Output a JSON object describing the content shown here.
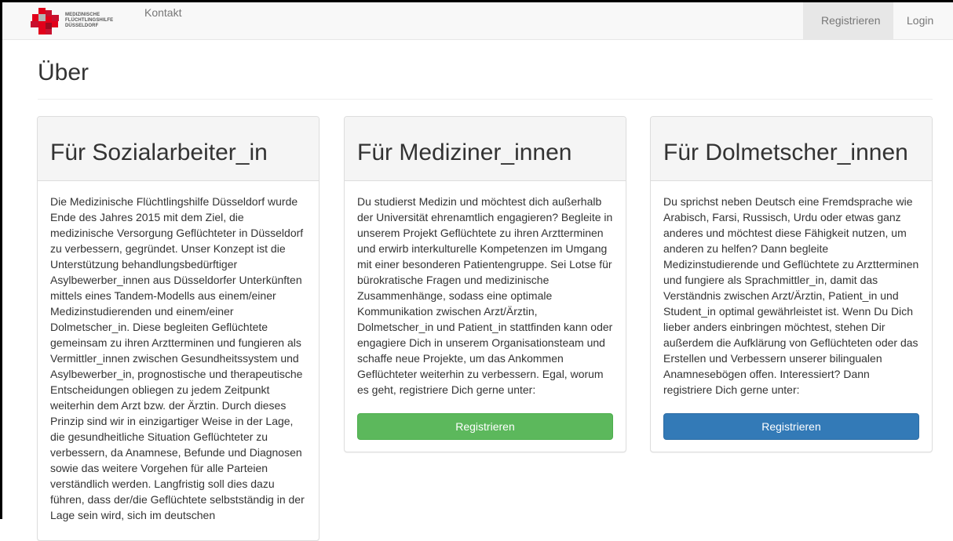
{
  "navbar": {
    "logo_lines": [
      "MEDIZINISCHE",
      "FLÜCHTLINGSHILFE",
      "DÜSSELDORF"
    ],
    "contact_label": "Kontakt",
    "register_label": "Registrieren",
    "login_label": "Login"
  },
  "page": {
    "title": "Über"
  },
  "panels": [
    {
      "heading": "Für Sozialarbeiter_in",
      "text": "Die Medizinische Flüchtlingshilfe Düsseldorf wurde Ende des Jahres 2015 mit dem Ziel, die medizinische Versorgung Geflüchteter in Düsseldorf zu verbessern, gegründet. Unser Konzept ist die Unterstützung behandlungsbedürftiger Asylbewerber_innen aus Düsseldorfer Unterkünften mittels eines Tandem-Modells aus einem/einer Medizinstudierenden und einem/einer Dolmetscher_in. Diese begleiten Geflüchtete gemeinsam zu ihren Arztterminen und fungieren als Vermittler_innen zwischen Gesundheitssystem und Asylbewerber_in, prognostische und therapeutische Entscheidungen obliegen zu jedem Zeitpunkt weiterhin dem Arzt bzw. der Ärztin. Durch dieses Prinzip sind wir in einzigartiger Weise in der Lage, die gesundheitliche Situation Geflüchteter zu verbessern, da Anamnese, Befunde und Diagnosen sowie das weitere Vorgehen für alle Parteien verständlich werden. Langfristig soll dies dazu führen, dass der/die Geflüchtete selbstständig in der Lage sein wird, sich im deutschen"
    },
    {
      "heading": "Für Mediziner_innen",
      "text": "Du studierst Medizin und möchtest dich außerhalb der Universität ehrenamtlich engagieren? Begleite in unserem Projekt Geflüchtete zu ihren Arztterminen und erwirb interkulturelle Kompetenzen im Umgang mit einer besonderen Patientengruppe. Sei Lotse für bürokratische Fragen und medizinische Zusammenhänge, sodass eine optimale Kommunikation zwischen Arzt/Ärztin, Dolmetscher_in und Patient_in stattfinden kann oder engagiere Dich in unserem Organisationsteam und schaffe neue Projekte, um das Ankommen Geflüchteter weiterhin zu verbessern. Egal, worum es geht, registriere Dich gerne unter:",
      "button": "Registrieren"
    },
    {
      "heading": "Für Dolmetscher_innen",
      "text": "Du sprichst neben Deutsch eine Fremdsprache wie Arabisch, Farsi, Russisch, Urdu oder etwas ganz anderes und möchtest diese Fähigkeit nutzen, um anderen zu helfen? Dann begleite Medizinstudierende und Geflüchtete zu Arztterminen und fungiere als Sprachmittler_in, damit das Verständnis zwischen Arzt/Ärztin, Patient_in und Student_in optimal gewährleistet ist. Wenn Du Dich lieber anders einbringen möchtest, stehen Dir außerdem die Aufklärung von Geflüchteten oder das Erstellen und Verbessern unserer bilingualen Anamnesebögen offen. Interessiert? Dann registriere Dich gerne unter:",
      "button": "Registrieren"
    }
  ],
  "colors": {
    "logo_red": "#e2001a",
    "logo_dark": "#9c0a1e",
    "logo_grey": "#b5b5b5",
    "button_green": "#5cb85c",
    "button_blue": "#337ab7"
  }
}
